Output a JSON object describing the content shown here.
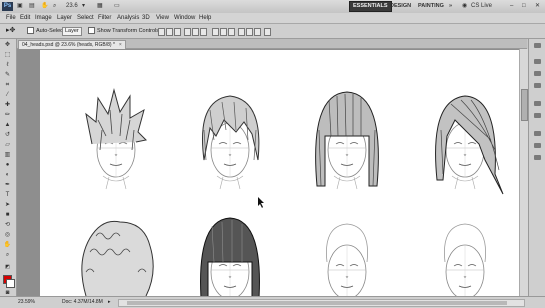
{
  "app": {
    "logo": "Ps",
    "zoom": "23.6",
    "workspace": [
      "ESSENTIALS",
      "DESIGN",
      "PAINTING"
    ],
    "more": "»",
    "cs_live": "CS Live"
  },
  "menu": [
    "File",
    "Edit",
    "Image",
    "Layer",
    "Select",
    "Filter",
    "Analysis",
    "3D",
    "View",
    "Window",
    "Help"
  ],
  "options": {
    "auto_select": "Auto-Select:",
    "auto_select_value": "Layer",
    "transform": "Show Transform Controls"
  },
  "document": {
    "tab": "04_heads.psd @ 23.6% (heads, RGB/8) *",
    "close": "×"
  },
  "status": {
    "zoom": "23.59%",
    "doc": "Doc: 4.37M/14.8M"
  },
  "colors": {
    "foreground": "#d40000",
    "background": "#ffffff",
    "accent": "#3a3a3a"
  },
  "icons": [
    "move-icon",
    "marquee-icon",
    "lasso-icon",
    "quick-select-icon",
    "crop-icon",
    "eyedropper-icon",
    "healing-icon",
    "brush-icon",
    "stamp-icon",
    "history-brush-icon",
    "eraser-icon",
    "gradient-icon",
    "blur-icon",
    "dodge-icon",
    "pen-icon",
    "type-icon",
    "path-select-icon",
    "shape-icon",
    "3d-rotate-icon",
    "3d-orbit-icon",
    "hand-icon",
    "zoom-icon"
  ]
}
